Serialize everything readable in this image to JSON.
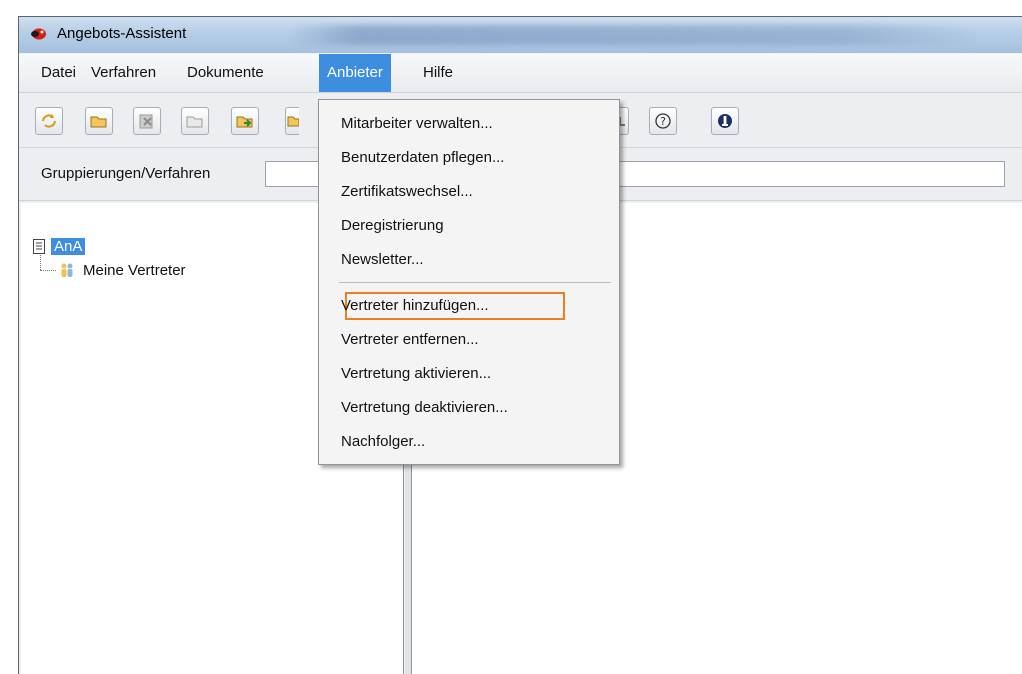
{
  "window": {
    "title": "Angebots-Assistent"
  },
  "menubar": {
    "items": [
      {
        "label": "Datei"
      },
      {
        "label": "Verfahren"
      },
      {
        "label": "Dokumente"
      },
      {
        "label": "Anbieter"
      },
      {
        "label": "Hilfe"
      }
    ],
    "active": "Anbieter"
  },
  "toolbar": {
    "buttons": [
      "refresh-icon",
      "open-folder-icon",
      "delete-icon",
      "close-folder-icon",
      "import-icon",
      "folder-icon",
      "help-icon",
      "info-icon"
    ]
  },
  "groupbar": {
    "label": "Gruppierungen/Verfahren",
    "value": ""
  },
  "tree": {
    "root": "AnA",
    "child": "Meine Vertreter"
  },
  "dropdown": {
    "items": [
      "Mitarbeiter verwalten...",
      "Benutzerdaten pflegen...",
      "Zertifikatswechsel...",
      "Deregistrierung",
      "Newsletter...",
      "Vertreter hinzufügen...",
      "Vertreter entfernen...",
      "Vertretung aktivieren...",
      "Vertretung deaktivieren...",
      "Nachfolger..."
    ],
    "highlighted": "Vertreter hinzufügen...",
    "highlight_color": "#ef7d22"
  },
  "colors": {
    "selection": "#3d8ee0"
  }
}
